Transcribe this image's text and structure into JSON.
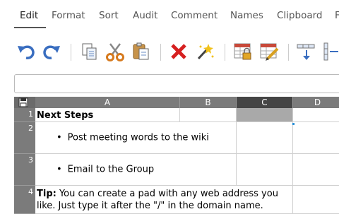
{
  "menu": {
    "tabs": [
      "Edit",
      "Format",
      "Sort",
      "Audit",
      "Comment",
      "Names",
      "Clipboard",
      "F"
    ],
    "active": "Edit"
  },
  "toolbar": {
    "icons": [
      "undo-icon",
      "redo-icon",
      "copy-icon",
      "cut-icon",
      "paste-icon",
      "delete-icon",
      "magic-wand-icon",
      "lock-cell-icon",
      "edit-cell-icon",
      "insert-row-icon",
      "insert-column-icon"
    ]
  },
  "formula": {
    "value": ""
  },
  "grid": {
    "columns": [
      "A",
      "B",
      "C",
      "D"
    ],
    "selected_column": "C",
    "rows": [
      "1",
      "2",
      "3",
      "4"
    ],
    "cells": {
      "A1": "Next Steps",
      "A2": "Post meeting words to the wiki",
      "A3": "Email to the Group",
      "A4_bold": "Tip:",
      "A4_text": " You can create a pad with any web address you like. Just type it after the \"/\" in the domain name."
    }
  },
  "colors": {
    "header": "#7b7b7b",
    "selected_header": "#444444",
    "selected_cell": "#a9a9a9",
    "accent": "#2a8fd6"
  }
}
